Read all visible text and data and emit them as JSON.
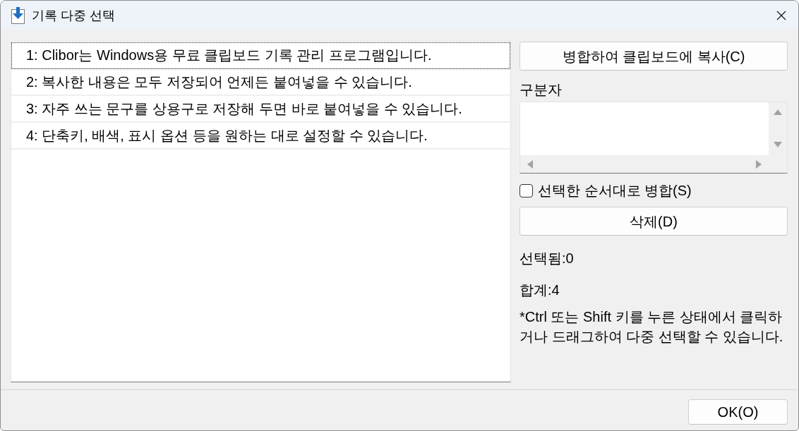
{
  "window": {
    "title": "기록 다중 선택"
  },
  "history_list": {
    "items": [
      {
        "text": "1: Clibor는 Windows용 무료 클립보드 기록 관리 프로그램입니다.",
        "focused": true,
        "selected": false
      },
      {
        "text": "2: 복사한 내용은 모두 저장되어 언제든 붙여넣을 수 있습니다.",
        "focused": false,
        "selected": false
      },
      {
        "text": "3: 자주 쓰는 문구를 상용구로 저장해 두면 바로 붙여넣을 수 있습니다.",
        "focused": false,
        "selected": false
      },
      {
        "text": "4: 단축키, 배색, 표시 옵션 등을 원하는 대로 설정할 수 있습니다.",
        "focused": false,
        "selected": false
      }
    ]
  },
  "copy_button": {
    "label": "병합하여 클립보드에 복사(C)"
  },
  "separator_field": {
    "label": "구분자"
  },
  "merge_in_order": {
    "label": "선택한 순서대로 병합(S)",
    "checked": false
  },
  "delete_button": {
    "label": "삭제(D)"
  },
  "selected_count": "선택됨:0",
  "total_count": "합계:4",
  "hint": "*Ctrl 또는 Shift 키를 누른 상태에서 클릭하거나 드래그하여 다중 선택할 수 있습니다.",
  "ok_button": {
    "label": "OK(O)"
  }
}
